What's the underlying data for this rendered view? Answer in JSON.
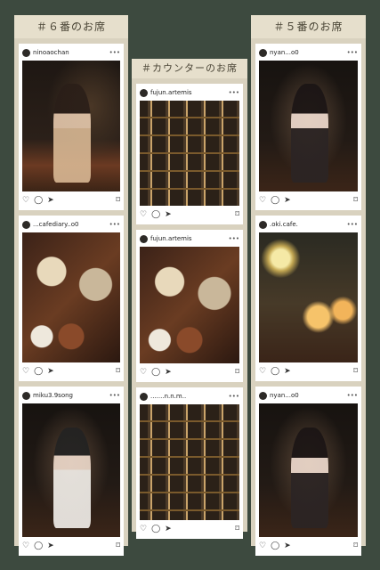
{
  "columns": {
    "left": {
      "title": "＃６番のお席",
      "posts": [
        {
          "username": "ninoaochan",
          "scene": "person with drink at bar counter"
        },
        {
          "username": "...cafediary..o0",
          "scene": "desserts on table"
        },
        {
          "username": "miku3.9song",
          "scene": "person with desserts"
        }
      ]
    },
    "middle": {
      "title": "＃カウンターのお席",
      "posts": [
        {
          "username": "fujun.artemis",
          "scene": "shelf with bottles"
        },
        {
          "username": "fujun.artemis",
          "scene": "desserts close-up"
        },
        {
          "username": ".......n.n.m..",
          "scene": "counter with desserts"
        }
      ]
    },
    "right": {
      "title": "＃５番のお席",
      "posts": [
        {
          "username": "nyan...o0",
          "scene": "person at seat"
        },
        {
          "username": ".oki.cafe.",
          "scene": "parfaits with lamp"
        },
        {
          "username": "nyan...o0",
          "scene": "person holding dessert"
        }
      ]
    }
  },
  "icons": {
    "more": "ellipsis-icon",
    "like": "heart-icon",
    "comment": "comment-icon",
    "share": "send-icon",
    "save": "bookmark-icon"
  },
  "colors": {
    "background": "#3d4a3f",
    "panel": "#d9d2bf",
    "header": "#e6dfcc"
  }
}
